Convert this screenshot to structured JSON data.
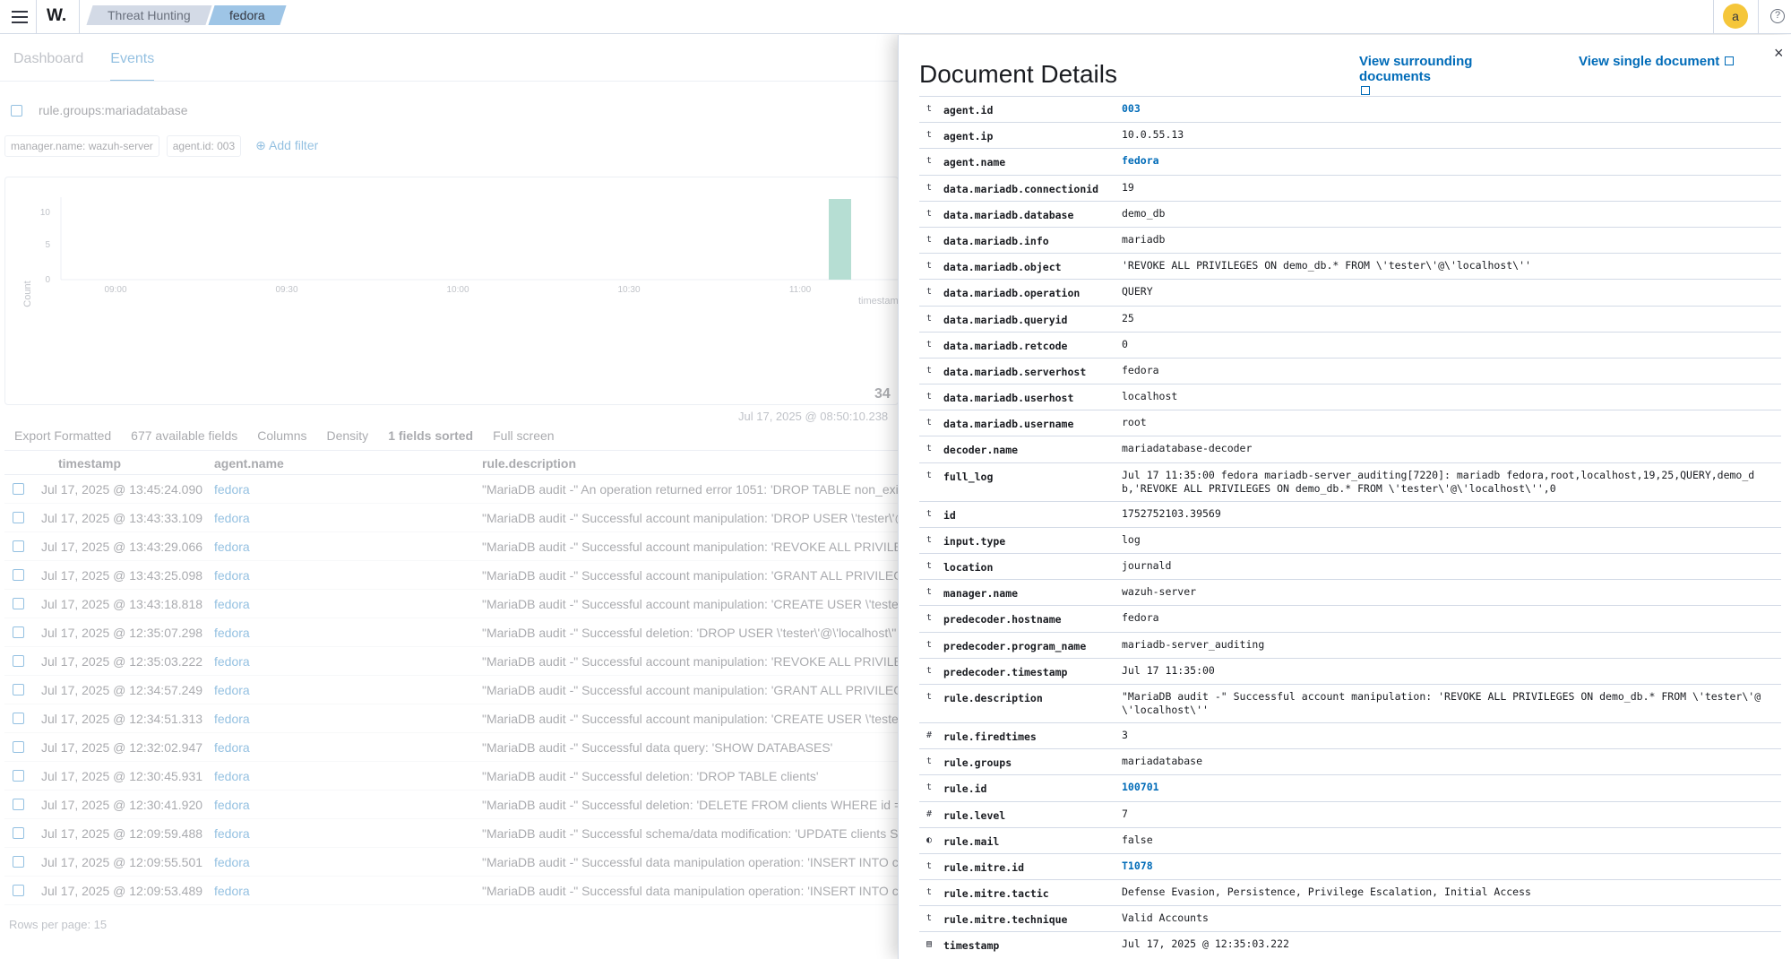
{
  "header": {
    "logo": "W.",
    "breadcrumbs": [
      "Threat Hunting",
      "fedora"
    ],
    "avatar": "a",
    "help": "?"
  },
  "tabs": [
    "Dashboard",
    "Events"
  ],
  "query": "rule.groups:mariadatabase",
  "filters": [
    "manager.name: wazuh-server",
    "agent.id: 003"
  ],
  "add_filter": "Add filter",
  "histogram": {
    "y_label": "Count",
    "x_label": "timestamp",
    "y_ticks": [
      "10",
      "5",
      "0"
    ],
    "x_ticks": [
      "09:00",
      "09:30",
      "10:00",
      "10:30",
      "11:00"
    ]
  },
  "hits": "34",
  "time_range": "Jul 17, 2025 @ 08:50:10.238",
  "toolbar": {
    "export": "Export Formatted",
    "fields": "677 available fields",
    "columns": "Columns",
    "density": "Density",
    "sorted": "1 fields sorted",
    "fullscreen": "Full screen"
  },
  "table": {
    "columns": [
      "timestamp",
      "agent.name",
      "rule.description"
    ],
    "rows": [
      [
        "Jul 17, 2025 @ 13:45:24.090",
        "fedora",
        "\"MariaDB audit -\" An operation returned error 1051: 'DROP TABLE non_exis"
      ],
      [
        "Jul 17, 2025 @ 13:43:33.109",
        "fedora",
        "\"MariaDB audit -\" Successful account manipulation: 'DROP USER \\'tester\\'@"
      ],
      [
        "Jul 17, 2025 @ 13:43:29.066",
        "fedora",
        "\"MariaDB audit -\" Successful account manipulation: 'REVOKE ALL PRIVILEGE"
      ],
      [
        "Jul 17, 2025 @ 13:43:25.098",
        "fedora",
        "\"MariaDB audit -\" Successful account manipulation: 'GRANT ALL PRIVILEGE"
      ],
      [
        "Jul 17, 2025 @ 13:43:18.818",
        "fedora",
        "\"MariaDB audit -\" Successful account manipulation: 'CREATE USER \\'tester"
      ],
      [
        "Jul 17, 2025 @ 12:35:07.298",
        "fedora",
        "\"MariaDB audit -\" Successful deletion: 'DROP USER \\'tester\\'@\\'localhost\\''"
      ],
      [
        "Jul 17, 2025 @ 12:35:03.222",
        "fedora",
        "\"MariaDB audit -\" Successful account manipulation: 'REVOKE ALL PRIVILEG"
      ],
      [
        "Jul 17, 2025 @ 12:34:57.249",
        "fedora",
        "\"MariaDB audit -\" Successful account manipulation: 'GRANT ALL PRIVILEGE"
      ],
      [
        "Jul 17, 2025 @ 12:34:51.313",
        "fedora",
        "\"MariaDB audit -\" Successful account manipulation: 'CREATE USER \\'tester"
      ],
      [
        "Jul 17, 2025 @ 12:32:02.947",
        "fedora",
        "\"MariaDB audit -\" Successful data query: 'SHOW DATABASES'"
      ],
      [
        "Jul 17, 2025 @ 12:30:45.931",
        "fedora",
        "\"MariaDB audit -\" Successful deletion: 'DROP TABLE clients'"
      ],
      [
        "Jul 17, 2025 @ 12:30:41.920",
        "fedora",
        "\"MariaDB audit -\" Successful deletion: 'DELETE FROM clients WHERE id ="
      ],
      [
        "Jul 17, 2025 @ 12:09:59.488",
        "fedora",
        "\"MariaDB audit -\" Successful schema/data modification: 'UPDATE clients SE"
      ],
      [
        "Jul 17, 2025 @ 12:09:55.501",
        "fedora",
        "\"MariaDB audit -\" Successful data manipulation operation: 'INSERT INTO cli"
      ],
      [
        "Jul 17, 2025 @ 12:09:53.489",
        "fedora",
        "\"MariaDB audit -\" Successful data manipulation operation: 'INSERT INTO cli"
      ]
    ]
  },
  "rows_per_page": "Rows per page: 15",
  "flyout": {
    "title": "Document Details",
    "view_surrounding": "View surrounding documents",
    "view_single": "View single document",
    "close": "×",
    "fields": [
      {
        "type": "t",
        "name": "agent.id",
        "value": "003",
        "link": true
      },
      {
        "type": "t",
        "name": "agent.ip",
        "value": "10.0.55.13"
      },
      {
        "type": "t",
        "name": "agent.name",
        "value": "fedora",
        "link": true
      },
      {
        "type": "t",
        "name": "data.mariadb.connectionid",
        "value": "19"
      },
      {
        "type": "t",
        "name": "data.mariadb.database",
        "value": "demo_db"
      },
      {
        "type": "t",
        "name": "data.mariadb.info",
        "value": "mariadb"
      },
      {
        "type": "t",
        "name": "data.mariadb.object",
        "value": "'REVOKE ALL PRIVILEGES ON demo_db.* FROM \\'tester\\'@\\'localhost\\''"
      },
      {
        "type": "t",
        "name": "data.mariadb.operation",
        "value": "QUERY"
      },
      {
        "type": "t",
        "name": "data.mariadb.queryid",
        "value": "25"
      },
      {
        "type": "t",
        "name": "data.mariadb.retcode",
        "value": "0"
      },
      {
        "type": "t",
        "name": "data.mariadb.serverhost",
        "value": "fedora"
      },
      {
        "type": "t",
        "name": "data.mariadb.userhost",
        "value": "localhost"
      },
      {
        "type": "t",
        "name": "data.mariadb.username",
        "value": "root"
      },
      {
        "type": "t",
        "name": "decoder.name",
        "value": "mariadatabase-decoder"
      },
      {
        "type": "t",
        "name": "full_log",
        "value": "Jul 17 11:35:00 fedora mariadb-server_auditing[7220]: mariadb fedora,root,localhost,19,25,QUERY,demo_db,'REVOKE ALL PRIVILEGES ON demo_db.* FROM \\'tester\\'@\\'localhost\\'',0"
      },
      {
        "type": "t",
        "name": "id",
        "value": "1752752103.39569"
      },
      {
        "type": "t",
        "name": "input.type",
        "value": "log"
      },
      {
        "type": "t",
        "name": "location",
        "value": "journald"
      },
      {
        "type": "t",
        "name": "manager.name",
        "value": "wazuh-server"
      },
      {
        "type": "t",
        "name": "predecoder.hostname",
        "value": "fedora"
      },
      {
        "type": "t",
        "name": "predecoder.program_name",
        "value": "mariadb-server_auditing"
      },
      {
        "type": "t",
        "name": "predecoder.timestamp",
        "value": "Jul 17 11:35:00"
      },
      {
        "type": "t",
        "name": "rule.description",
        "value": "\"MariaDB audit -\" Successful account manipulation: 'REVOKE ALL PRIVILEGES ON demo_db.* FROM \\'tester\\'@\\'localhost\\''"
      },
      {
        "type": "#",
        "name": "rule.firedtimes",
        "value": "3"
      },
      {
        "type": "t",
        "name": "rule.groups",
        "value": "mariadatabase"
      },
      {
        "type": "t",
        "name": "rule.id",
        "value": "100701",
        "link": true
      },
      {
        "type": "#",
        "name": "rule.level",
        "value": "7"
      },
      {
        "type": "◐",
        "name": "rule.mail",
        "value": "false"
      },
      {
        "type": "t",
        "name": "rule.mitre.id",
        "value": "T1078",
        "link": true
      },
      {
        "type": "t",
        "name": "rule.mitre.tactic",
        "value": "Defense Evasion, Persistence, Privilege Escalation, Initial Access"
      },
      {
        "type": "t",
        "name": "rule.mitre.technique",
        "value": "Valid Accounts"
      },
      {
        "type": "▤",
        "name": "timestamp",
        "value": "Jul 17, 2025 @ 12:35:03.222"
      }
    ]
  },
  "colors": {
    "accent": "#006bb8",
    "avatar": "#f5c63a",
    "bar": "#54b399"
  }
}
